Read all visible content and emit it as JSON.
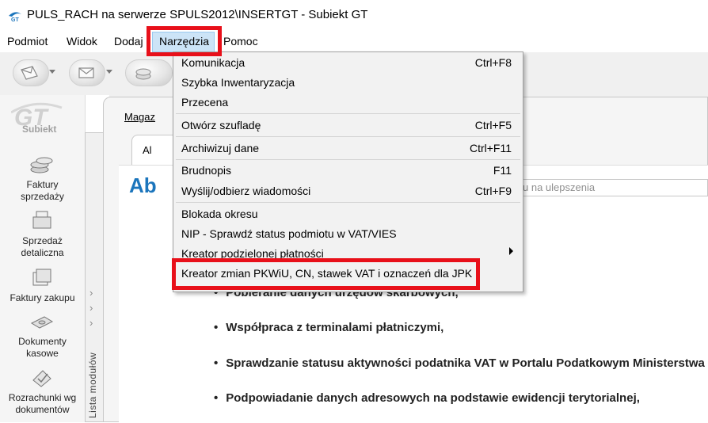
{
  "window": {
    "title": "PULS_RACH na serwerze SPULS2012\\INSERTGT - Subiekt GT"
  },
  "menubar": {
    "items": [
      {
        "label": "Podmiot"
      },
      {
        "label": "Widok"
      },
      {
        "label": "Dodaj"
      },
      {
        "label": "Narzędzia"
      },
      {
        "label": "Pomoc"
      }
    ]
  },
  "dropdown": {
    "items": [
      {
        "label": "Komunikacja",
        "shortcut": "Ctrl+F8"
      },
      {
        "label": "Szybka Inwentaryzacja",
        "shortcut": ""
      },
      {
        "label": "Przecena",
        "shortcut": ""
      },
      {
        "label": "Otwórz szufladę",
        "shortcut": "Ctrl+F5"
      },
      {
        "label": "Archiwizuj dane",
        "shortcut": "Ctrl+F11"
      },
      {
        "label": "Brudnopis",
        "shortcut": "F11"
      },
      {
        "label": "Wyślij/odbierz wiadomości",
        "shortcut": "Ctrl+F9"
      },
      {
        "label": "Blokada okresu",
        "shortcut": ""
      },
      {
        "label": "NIP - Sprawdź status podmiotu w VAT/VIES",
        "shortcut": ""
      },
      {
        "label": "Kreator podzielonej płatności",
        "shortcut": ""
      },
      {
        "label": "Kreator zmian PKWiU, CN, stawek VAT i oznaczeń dla JPK",
        "shortcut": ""
      }
    ]
  },
  "sidebar": {
    "logo_text": "Subiekt",
    "modules": [
      {
        "label_line1": "Faktury",
        "label_line2": "sprzedaży",
        "icon": "coins-icon"
      },
      {
        "label_line1": "Sprzedaż",
        "label_line2": "detaliczna",
        "icon": "cash-register-icon"
      },
      {
        "label_line1": "Faktury zakupu",
        "label_line2": "",
        "icon": "invoice-stack-icon"
      },
      {
        "label_line1": "Dokumenty",
        "label_line2": "kasowe",
        "icon": "cash-document-icon"
      },
      {
        "label_line1": "Rozrachunki wg",
        "label_line2": "dokumentów",
        "icon": "settlements-icon"
      }
    ],
    "strip_label": "Lista modułów"
  },
  "content": {
    "breadcrumb": "Magaz",
    "tab_label": "Al",
    "heading": "Ab",
    "search_placeholder": "u na ulepszenia",
    "bullets": [
      "Pobieranie danych urzędów skarbowych,",
      "Współpraca z terminalami płatniczymi,",
      "Sprawdzanie statusu aktywności podatnika VAT w Portalu Podatkowym Ministerstwa",
      "Podpowiadanie danych adresowych na podstawie ewidencji terytorialnej,"
    ]
  },
  "colors": {
    "highlight": "#e8101a",
    "heading": "#1b75bc",
    "menu_hover": "#cce4f7"
  }
}
